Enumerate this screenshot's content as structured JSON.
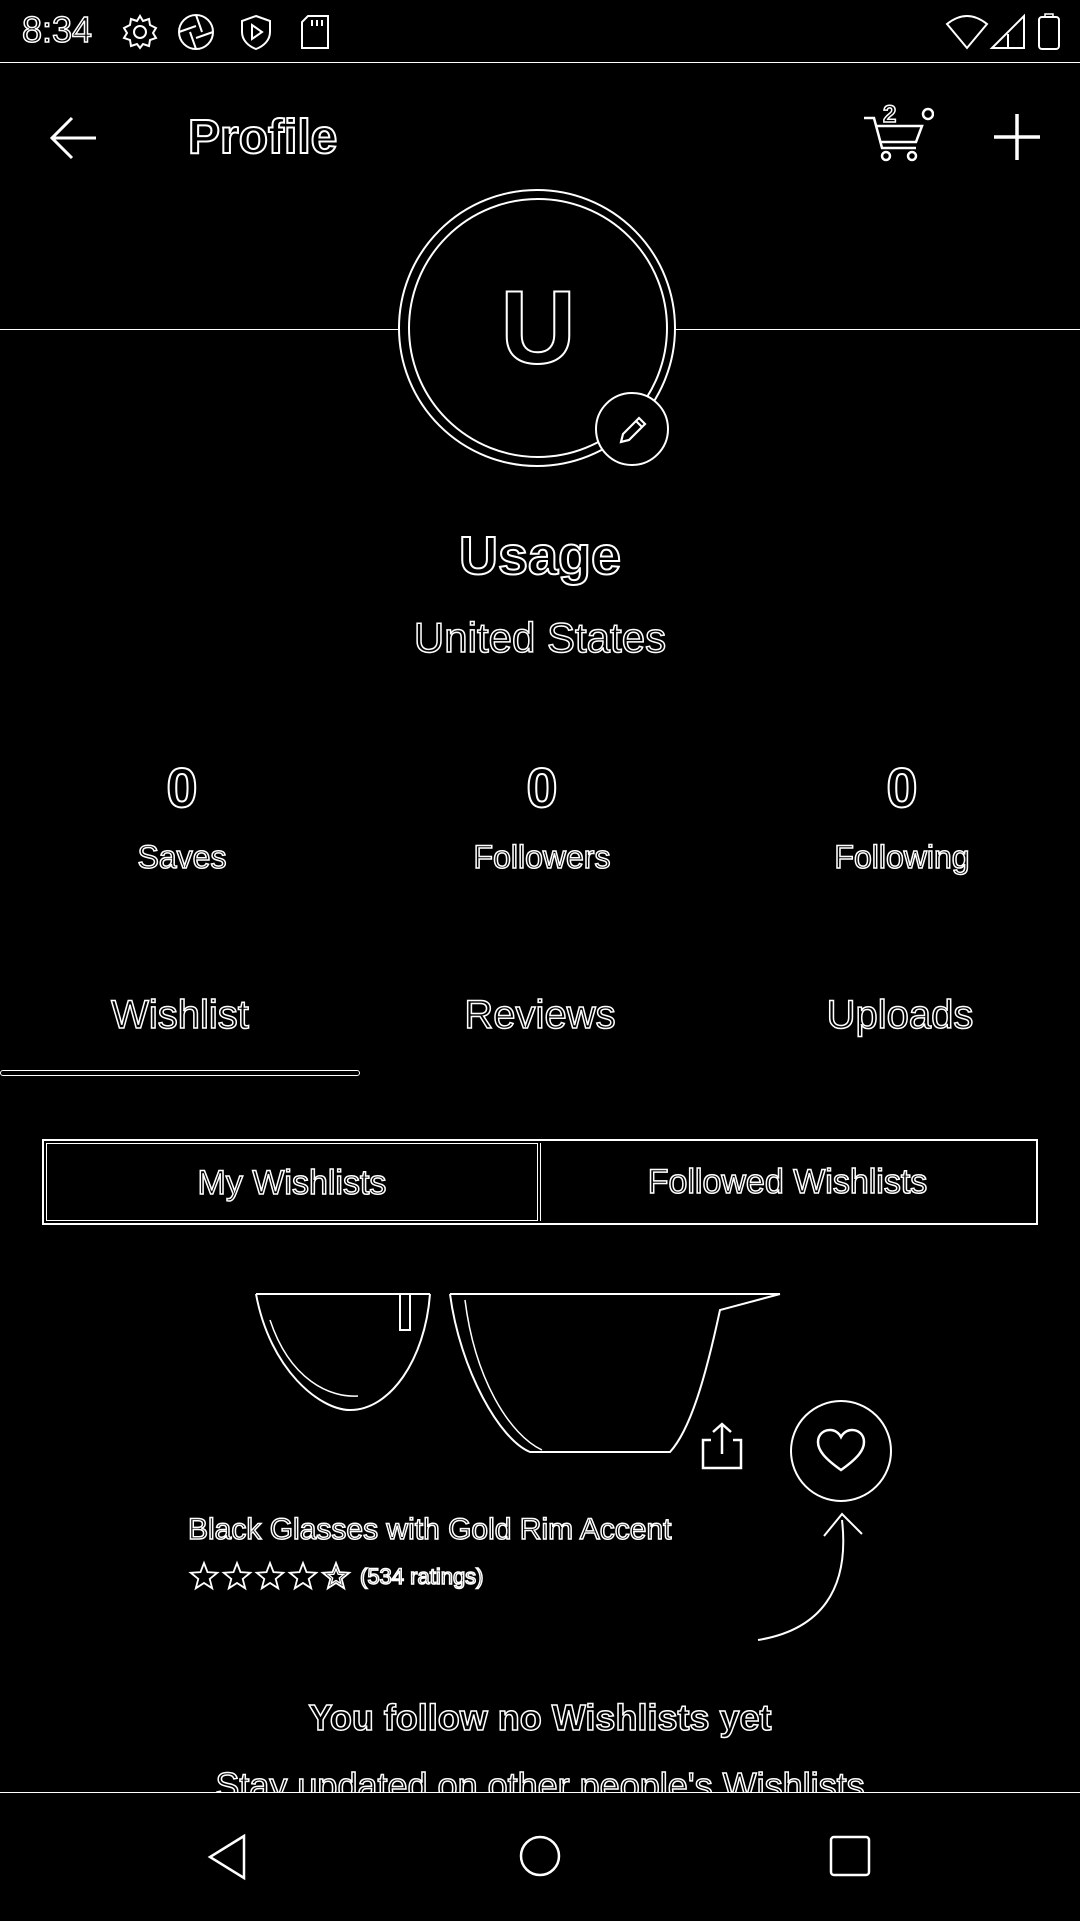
{
  "status_bar": {
    "time": "8:34",
    "left_icons": [
      "gear-icon",
      "shutter-icon",
      "play-protect-icon",
      "sd-card-icon"
    ],
    "right_icons": [
      "wifi-icon",
      "signal-icon",
      "battery-icon"
    ]
  },
  "header": {
    "title": "Profile",
    "cart_count": "2"
  },
  "profile": {
    "avatar_letter": "U",
    "name": "Usage",
    "location": "United States"
  },
  "stats": [
    {
      "value": "0",
      "label": "Saves"
    },
    {
      "value": "0",
      "label": "Followers"
    },
    {
      "value": "0",
      "label": "Following"
    }
  ],
  "tabs": [
    {
      "label": "Wishlist",
      "selected": true
    },
    {
      "label": "Reviews",
      "selected": false
    },
    {
      "label": "Uploads",
      "selected": false
    }
  ],
  "segments": [
    {
      "label": "My Wishlists",
      "selected": true
    },
    {
      "label": "Followed Wishlists",
      "selected": false
    }
  ],
  "product": {
    "title": "Black Glasses with Gold Rim Accent",
    "rating": 4.5,
    "ratings_text": "(534 ratings)"
  },
  "empty_state": {
    "title": "You follow no Wishlists yet",
    "subtitle": "Stay updated on other people's Wishlists"
  }
}
